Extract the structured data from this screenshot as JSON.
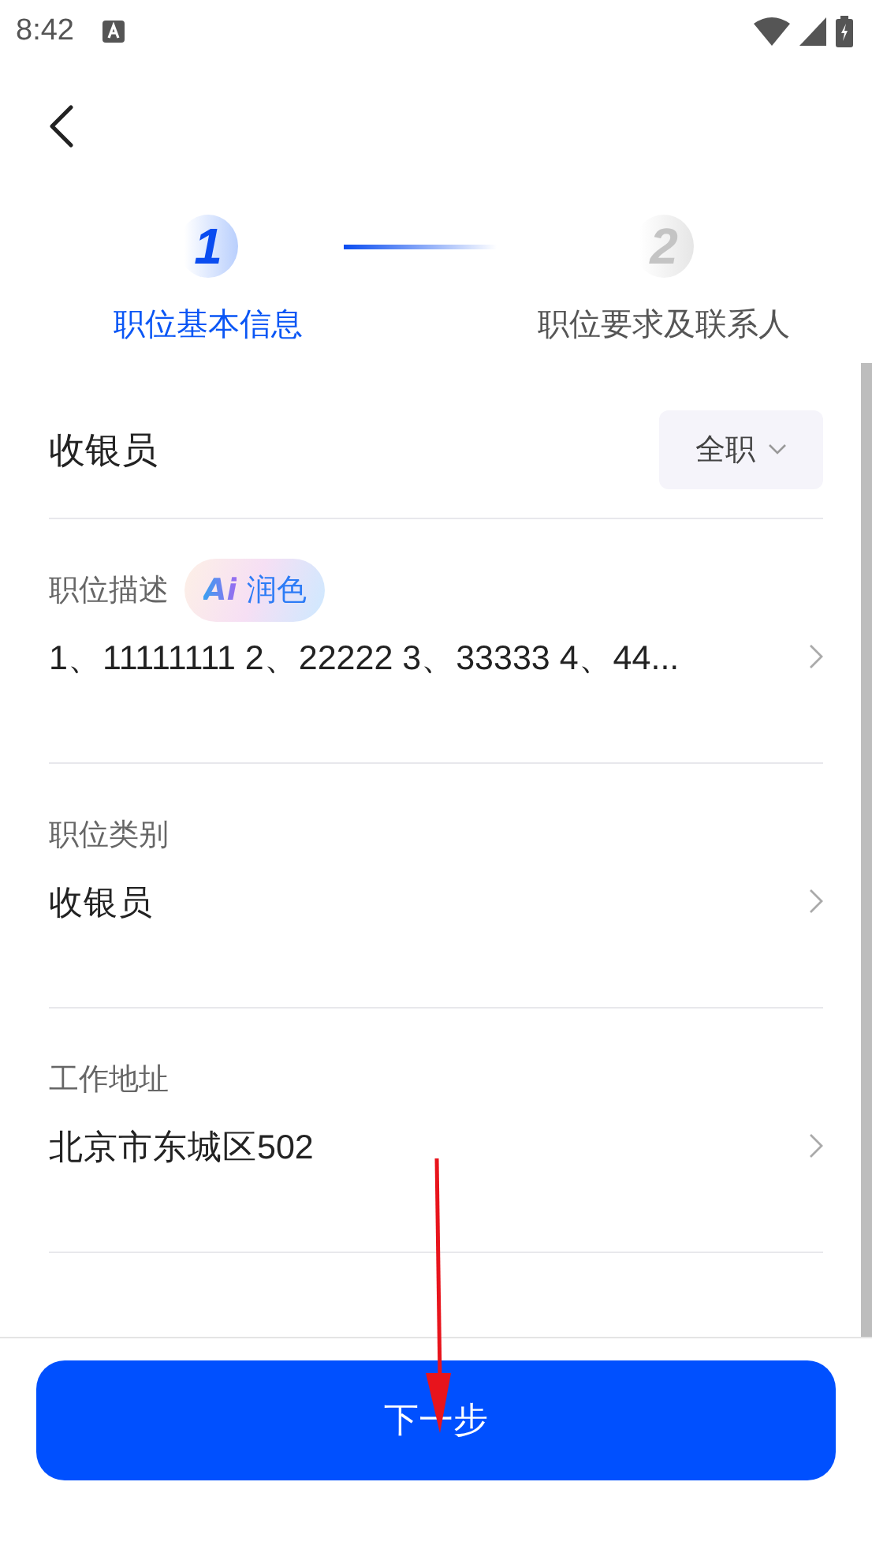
{
  "status_bar": {
    "time": "8:42"
  },
  "steps": [
    {
      "number": "1",
      "label": "职位基本信息",
      "selected": true
    },
    {
      "number": "2",
      "label": "职位要求及联系人",
      "selected": false
    }
  ],
  "job_title": {
    "value": "收银员",
    "type_chip": "全职"
  },
  "fields": [
    {
      "label": "职位描述",
      "badge": {
        "mark": "Ai",
        "text": "润色"
      },
      "value": "1、11111111 2、22222 3、33333 4、44..."
    },
    {
      "label": "职位类别",
      "value": "收银员"
    },
    {
      "label": "工作地址",
      "value": "北京市东城区502"
    }
  ],
  "next_button": "下一步",
  "annotations": [
    {
      "kind": "arrow"
    }
  ]
}
